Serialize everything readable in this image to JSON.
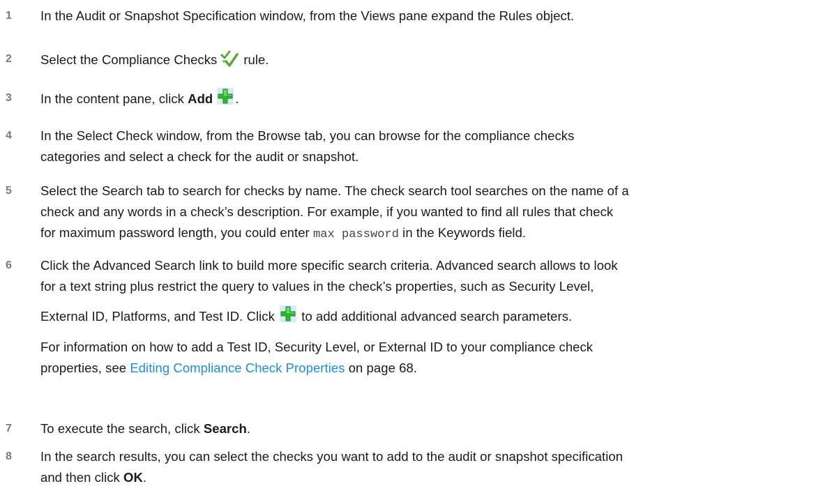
{
  "steps": [
    {
      "number": "1",
      "lines": [
        "In the Audit or Snapshot Specification window, from the Views pane expand the Rules object."
      ]
    },
    {
      "number": "2",
      "before": "Select the Compliance Checks",
      "after": "rule.",
      "icon": "compliance-checks-icon"
    },
    {
      "number": "3",
      "before": "In the content pane, click ",
      "bold": "Add",
      "after": ".",
      "icon": "add-icon"
    },
    {
      "number": "4",
      "lines": [
        "In the Select Check window, from the Browse tab, you can browse for the compliance checks",
        "categories and select a check for the audit or snapshot."
      ]
    },
    {
      "number": "5",
      "lines": [
        "Select the Search tab to search for checks by name. The check search tool searches on the name of a",
        "check and any words in a check’s description. For example, if you wanted to find all rules that check"
      ],
      "line3_before": "for maximum password length, you could enter ",
      "line3_code": "max password",
      "line3_after": " in the Keywords field."
    },
    {
      "number": "6",
      "lines": [
        "Click the Advanced Search link to build more specific search criteria. Advanced search allows to look",
        "for a text string plus restrict the query to values in the check’s properties, such as Security Level,"
      ],
      "line3_before": "External ID, Platforms, and Test ID. Click ",
      "line3_after": " to add additional advanced search parameters.",
      "icon": "add-icon",
      "note_line1": "For information on how to add a Test ID, Security Level, or External ID to your compliance check",
      "note_before": "properties, see ",
      "note_link": "Editing Compliance Check Properties",
      "note_after": " on page 68."
    },
    {
      "number": "7",
      "before": "To execute the search, click ",
      "bold": "Search",
      "after": "."
    },
    {
      "number": "8",
      "lines": [
        "In the search results, you can select the checks you want to add to the audit or snapshot specification"
      ],
      "line2_before": "and then click ",
      "line2_bold": "OK",
      "line2_after": "."
    }
  ],
  "colors": {
    "text": "#1a1a1a",
    "number": "#7a7a7a",
    "link": "#1e8fd6",
    "add_icon_green": "#2fb82f"
  }
}
